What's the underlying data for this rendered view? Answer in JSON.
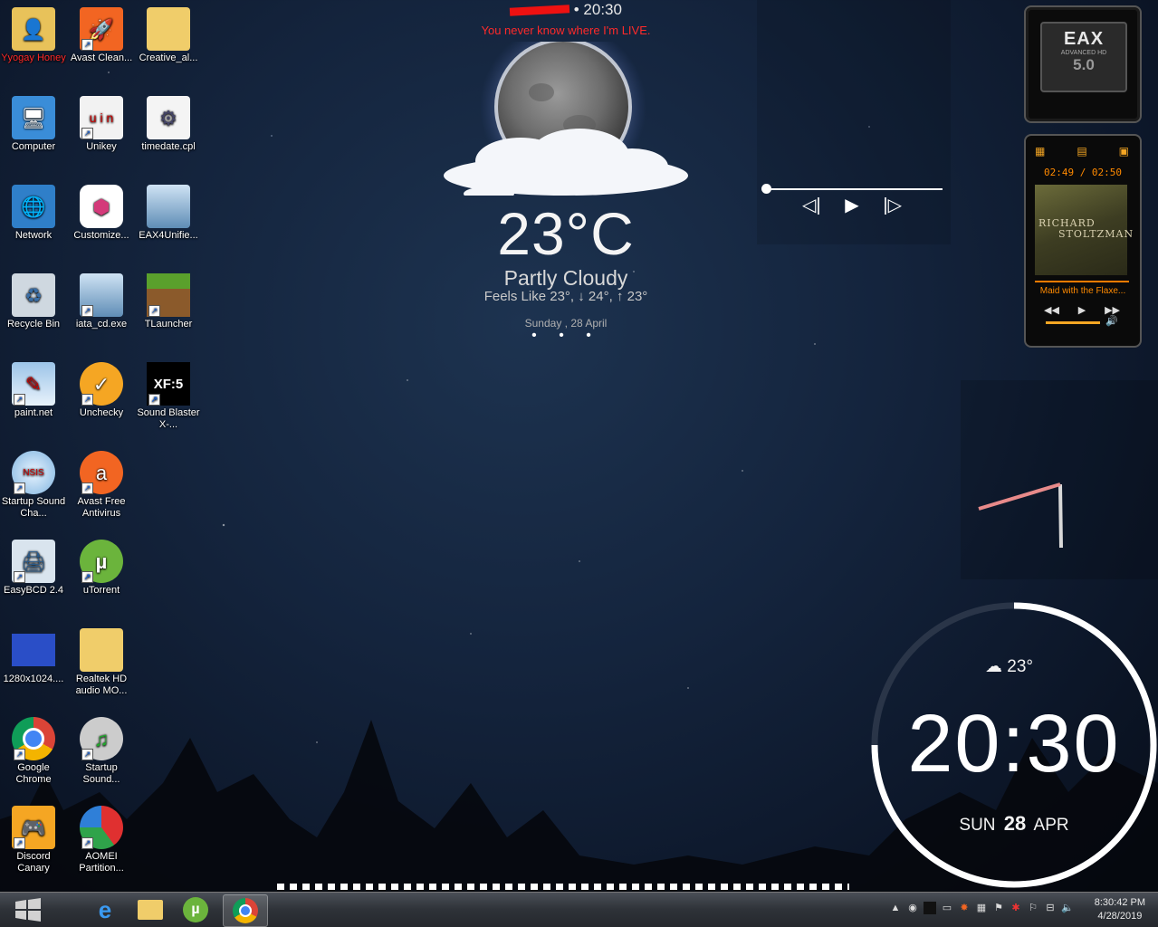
{
  "desktop": {
    "icons": [
      {
        "label": "Yyogay Honey",
        "name": "user-folder-icon"
      },
      {
        "label": "Avast Clean...",
        "name": "avast-cleanup-icon"
      },
      {
        "label": "Creative_al...",
        "name": "folder-icon"
      },
      {
        "label": "Computer",
        "name": "computer-icon"
      },
      {
        "label": "Unikey",
        "name": "unikey-icon"
      },
      {
        "label": "timedate.cpl",
        "name": "timedate-cpl-icon"
      },
      {
        "label": "Network",
        "name": "network-icon"
      },
      {
        "label": "Customize...",
        "name": "customize-icon"
      },
      {
        "label": "EAX4Unifie...",
        "name": "eax4unified-icon"
      },
      {
        "label": "Recycle Bin",
        "name": "recycle-bin-icon"
      },
      {
        "label": "iata_cd.exe",
        "name": "iata-cd-icon"
      },
      {
        "label": "TLauncher",
        "name": "tlauncher-icon"
      },
      {
        "label": "paint.net",
        "name": "paint-net-icon"
      },
      {
        "label": "Unchecky",
        "name": "unchecky-icon"
      },
      {
        "label": "Sound Blaster X-...",
        "name": "sound-blaster-icon"
      },
      {
        "label": "Startup Sound Cha...",
        "name": "startup-sound-changer-icon"
      },
      {
        "label": "Avast Free Antivirus",
        "name": "avast-antivirus-icon"
      },
      {
        "label": "EasyBCD 2.4",
        "name": "easybcd-icon"
      },
      {
        "label": "uTorrent",
        "name": "utorrent-icon"
      },
      {
        "label": "1280x1024....",
        "name": "image-file-icon"
      },
      {
        "label": "Realtek HD audio MO...",
        "name": "folder-icon"
      },
      {
        "label": "Google Chrome",
        "name": "chrome-icon"
      },
      {
        "label": "Startup Sound...",
        "name": "startup-sound-icon"
      },
      {
        "label": "Discord Canary",
        "name": "discord-canary-icon"
      },
      {
        "label": "AOMEI Partition...",
        "name": "aomei-partition-icon"
      }
    ]
  },
  "weather": {
    "top_time": "• 20:30",
    "tagline": "You never know where I'm LIVE.",
    "temperature": "23°C",
    "condition": "Partly Cloudy",
    "feels_like": "Feels Like 23°, ↓ 24°, ↑ 23°",
    "date": "Sunday , 28 April",
    "dots": "• • •"
  },
  "player": {
    "controls": {
      "prev": "◁|",
      "play": "▶",
      "next": "|▷"
    }
  },
  "eax": {
    "title": "EAX",
    "subtitle": "ADVANCED HD",
    "version": "5.0"
  },
  "music": {
    "time": "02:49 / 02:50",
    "artist_line1": "RICHARD",
    "artist_line2": "STOLTZMAN",
    "song": "Maid with the Flaxe...",
    "ctrl_prev": "◀◀",
    "ctrl_play": "▶",
    "ctrl_next": "▶▶",
    "volume_icon": "🔊"
  },
  "bigclock": {
    "weather": "23°",
    "time": "20:30",
    "day": "SUN",
    "date": "28",
    "month": "APR"
  },
  "taskbar": {
    "clock_time": "8:30:42 PM",
    "clock_date": "4/28/2019",
    "tray_expand": "▲"
  },
  "colors": {
    "accent_red": "#ff2a2a",
    "music_orange": "#ff8a00"
  }
}
